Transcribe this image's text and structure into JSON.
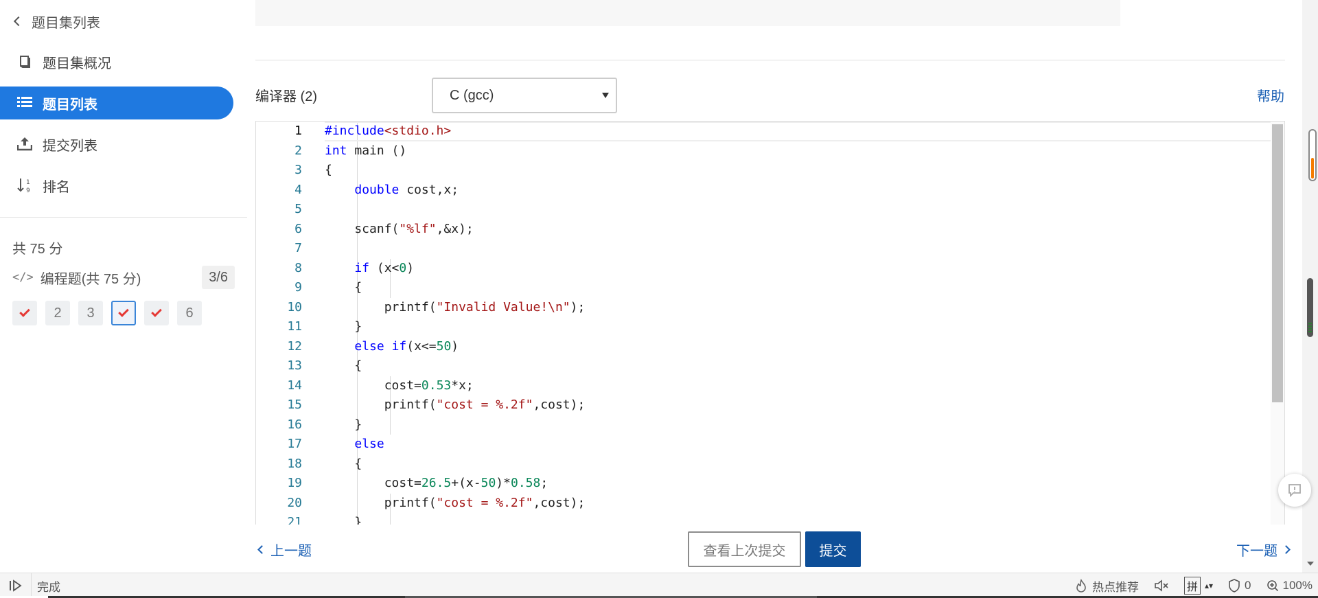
{
  "sidebar": {
    "back_label": "题目集列表",
    "nav": [
      {
        "label": "题目集概况",
        "icon": "book-icon",
        "active": false
      },
      {
        "label": "题目列表",
        "icon": "list-icon",
        "active": true
      },
      {
        "label": "提交列表",
        "icon": "upload-icon",
        "active": false
      },
      {
        "label": "排名",
        "icon": "sort-numeric-icon",
        "active": false
      }
    ],
    "total": "共 75 分",
    "section": {
      "label": "编程题(共 75 分)",
      "count": "3/6"
    },
    "questions": [
      {
        "label": "",
        "status": "correct"
      },
      {
        "label": "2",
        "status": "none"
      },
      {
        "label": "3",
        "status": "none"
      },
      {
        "label": "",
        "status": "correct-current"
      },
      {
        "label": "",
        "status": "correct"
      },
      {
        "label": "6",
        "status": "none"
      }
    ]
  },
  "main": {
    "compiler_label": "编译器 (2)",
    "compiler_value": "C (gcc)",
    "help_label": "帮助",
    "code_lines": [
      "#include<stdio.h>",
      "int main ()",
      "{",
      "    double cost,x;",
      "",
      "    scanf(\"%lf\",&x);",
      "",
      "    if (x<0)",
      "    {",
      "        printf(\"Invalid Value!\\n\");",
      "    }",
      "    else if(x<=50)",
      "    {",
      "        cost=0.53*x;",
      "        printf(\"cost = %.2f\",cost);",
      "    }",
      "    else",
      "    {",
      "        cost=26.5+(x-50)*0.58;",
      "        printf(\"cost = %.2f\",cost);",
      "    }"
    ],
    "prev_label": "上一题",
    "next_label": "下一题",
    "view_last_label": "查看上次提交",
    "submit_label": "提交"
  },
  "statusbar": {
    "status": "完成",
    "hot": "热点推荐",
    "ime": "拼",
    "ad_count": "0",
    "zoom": "100%"
  },
  "colors": {
    "accent": "#1f79e0",
    "submit": "#0d4e98",
    "link": "#1a5fb4",
    "check": "#e53935"
  }
}
